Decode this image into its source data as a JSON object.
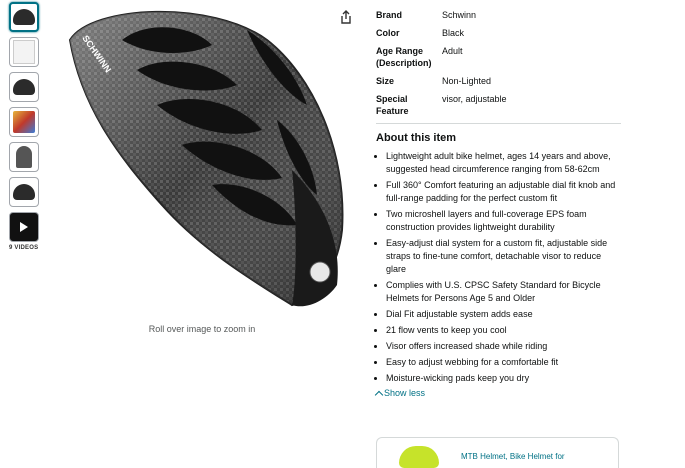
{
  "thumbnails": {
    "videos_label": "9 VIDEOS"
  },
  "image": {
    "zoom_hint": "Roll over image to zoom in",
    "helmet_brand_text": "SCHWINN"
  },
  "details": [
    {
      "key": "Brand",
      "value": "Schwinn"
    },
    {
      "key": "Color",
      "value": "Black"
    },
    {
      "key": "Age Range (Description)",
      "value": "Adult"
    },
    {
      "key": "Size",
      "value": "Non-Lighted"
    },
    {
      "key": "Special Feature",
      "value": "visor, adjustable"
    }
  ],
  "about": {
    "title": "About this item",
    "bullets": [
      "Lightweight adult bike helmet, ages 14 years and above, suggested head circumference ranging from 58-62cm",
      "Full 360° Comfort featuring an adjustable dial fit knob and full-range padding for the perfect custom fit",
      "Two microshell layers and full-coverage EPS foam construction provides lightweight durability",
      "Easy-adjust dial system for a custom fit, adjustable side straps to fine-tune comfort, detachable visor to reduce glare",
      "Complies with U.S. CPSC Safety Standard for Bicycle Helmets for Persons Age 5 and Older",
      "Dial Fit adjustable system adds ease",
      "21 flow vents to keep you cool",
      "Visor offers increased shade while riding",
      "Easy to adjust webbing for a comfortable fit",
      "Moisture-wicking pads keep you dry"
    ],
    "show_less": "Show less"
  },
  "bottom_card": {
    "text": "MTB Helmet, Bike Helmet for"
  }
}
